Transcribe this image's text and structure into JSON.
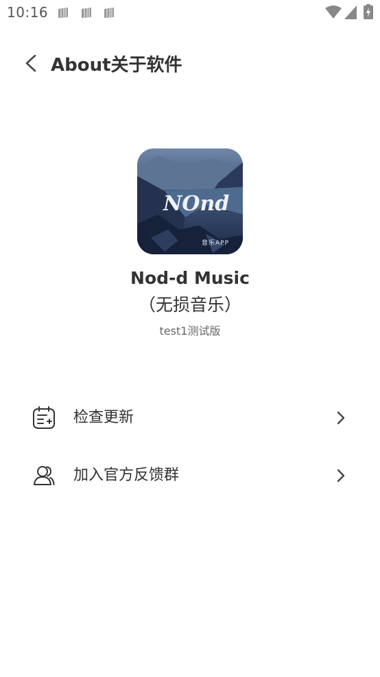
{
  "status_bar": {
    "time": "10:16",
    "notification_icons": [
      "notification-icon",
      "notification-icon",
      "notification-icon"
    ],
    "system_icons": [
      "wifi-icon",
      "signal-icon",
      "battery-charging-icon"
    ]
  },
  "header": {
    "back_icon": "back-arrow-icon",
    "title": "About关于软件"
  },
  "app": {
    "logo_icon": "app-logo",
    "logo_text": "NOnd",
    "logo_caption": "音乐APP",
    "name": "Nod-d Music",
    "subtitle": "（无损音乐）",
    "version": "test1测试版"
  },
  "menu": {
    "items": [
      {
        "label": "检查更新",
        "icon": "check-update-icon"
      },
      {
        "label": "加入官方反馈群",
        "icon": "users-icon"
      }
    ]
  },
  "colors": {
    "background": "#ffffff",
    "text_primary": "#333333",
    "text_secondary": "#666666",
    "status_icon": "#888888"
  }
}
